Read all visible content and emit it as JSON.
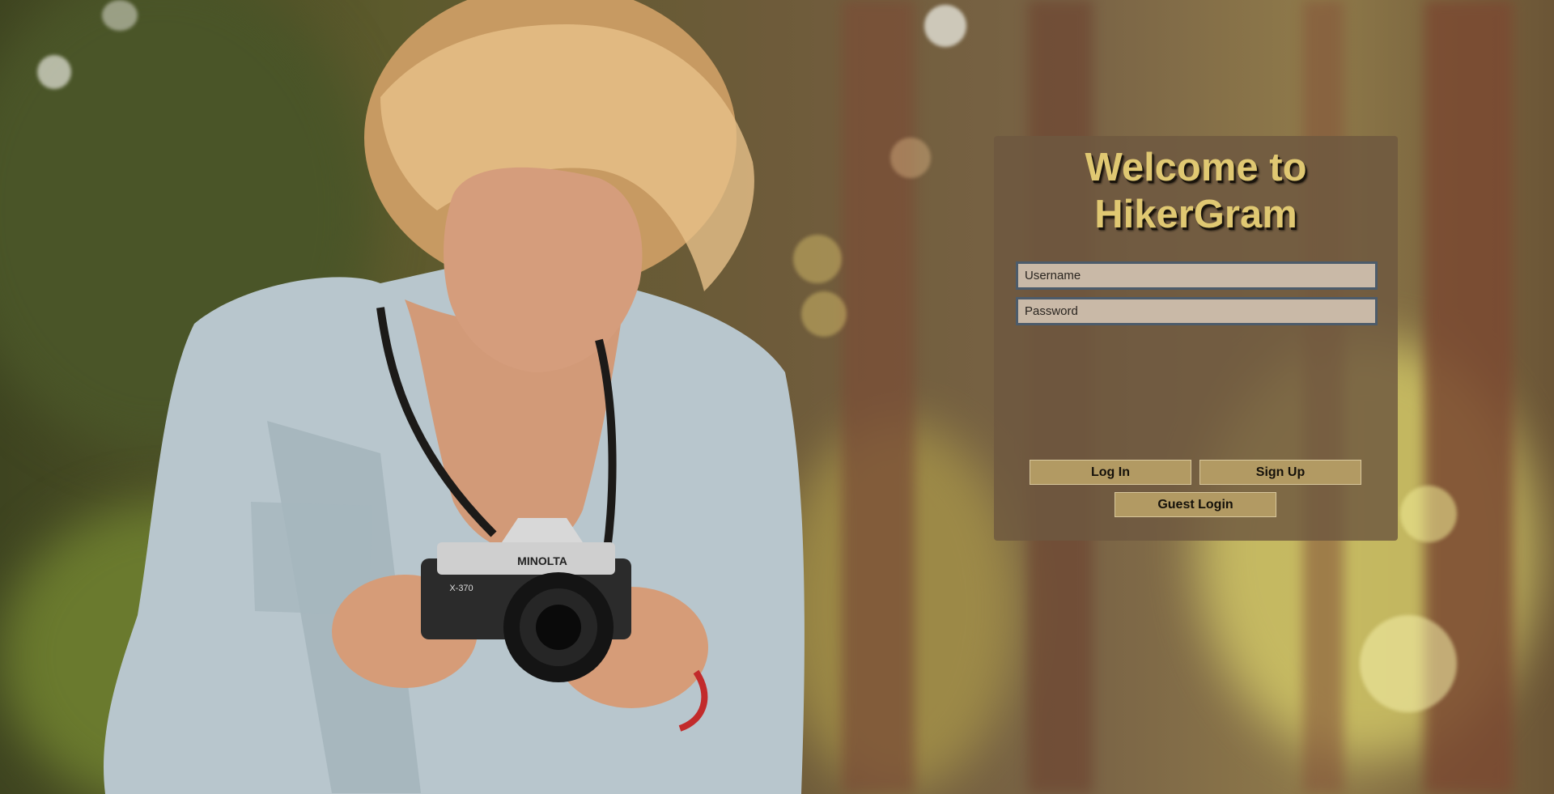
{
  "login": {
    "title_line1": "Welcome to",
    "title_line2": "HikerGram",
    "username_placeholder": "Username",
    "password_placeholder": "Password",
    "login_label": "Log In",
    "signup_label": "Sign Up",
    "guest_label": "Guest Login"
  },
  "photo": {
    "camera_brand": "MINOLTA",
    "camera_model": "X-370"
  },
  "colors": {
    "title": "#e0c872",
    "panel": "#6e5840",
    "button": "#b29a63",
    "field": "#c9b9a7",
    "field_border": "#4c5b6a"
  }
}
